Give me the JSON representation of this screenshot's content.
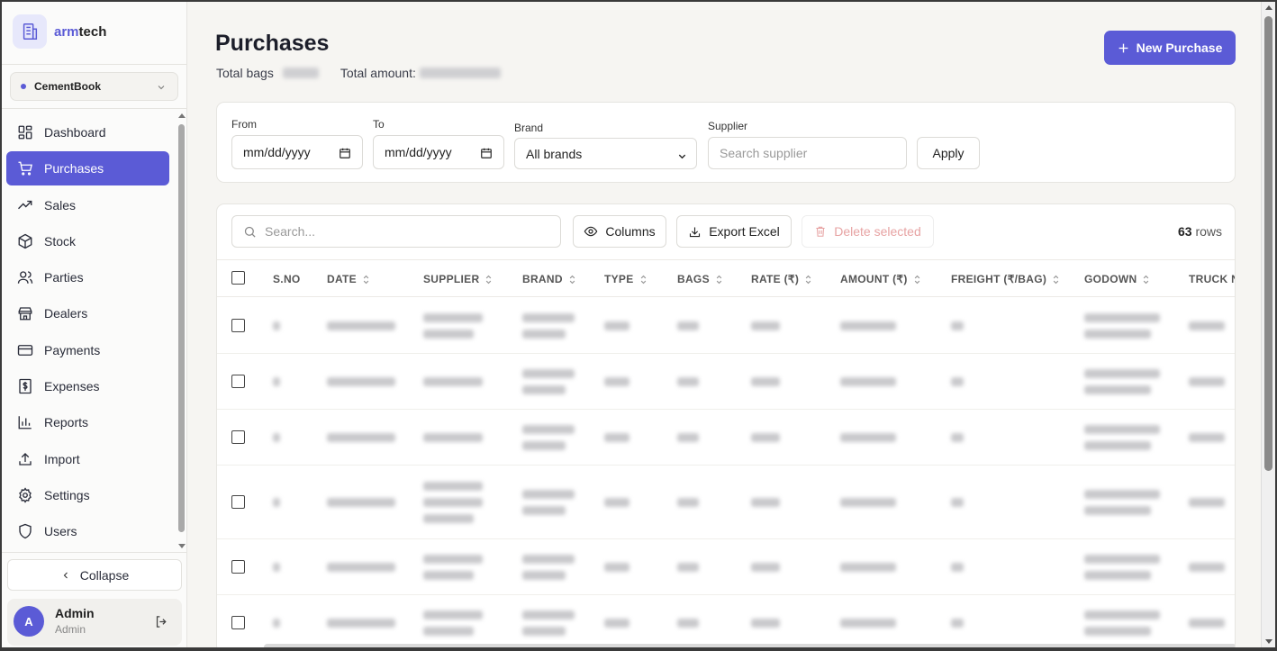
{
  "app": {
    "brand_prefix": "arm",
    "brand_suffix": "tech"
  },
  "company": {
    "name": "CementBook"
  },
  "nav": {
    "items": [
      {
        "label": "Dashboard",
        "icon": "dashboard-icon"
      },
      {
        "label": "Purchases",
        "icon": "cart-icon",
        "active": true
      },
      {
        "label": "Sales",
        "icon": "trend-icon"
      },
      {
        "label": "Stock",
        "icon": "box-icon"
      },
      {
        "label": "Parties",
        "icon": "users-icon"
      },
      {
        "label": "Dealers",
        "icon": "store-icon"
      },
      {
        "label": "Payments",
        "icon": "card-icon"
      },
      {
        "label": "Expenses",
        "icon": "receipt-icon"
      },
      {
        "label": "Reports",
        "icon": "bar-chart-icon"
      },
      {
        "label": "Import",
        "icon": "upload-icon"
      },
      {
        "label": "Settings",
        "icon": "gear-icon"
      },
      {
        "label": "Users",
        "icon": "shield-icon"
      }
    ],
    "collapse_label": "Collapse"
  },
  "user": {
    "initial": "A",
    "name": "Admin",
    "role": "Admin"
  },
  "header": {
    "title": "Purchases",
    "total_bags_label": "Total bags",
    "total_amount_label": "Total amount:",
    "new_button": "New Purchase"
  },
  "filters": {
    "from_label": "From",
    "from_placeholder": "mm/dd/yyyy",
    "to_label": "To",
    "to_placeholder": "mm/dd/yyyy",
    "brand_label": "Brand",
    "brand_value": "All brands",
    "supplier_label": "Supplier",
    "supplier_placeholder": "Search supplier",
    "apply_label": "Apply"
  },
  "toolbar": {
    "search_placeholder": "Search...",
    "columns_label": "Columns",
    "export_label": "Export Excel",
    "delete_label": "Delete selected",
    "row_count": "63",
    "row_count_suffix": "rows"
  },
  "table": {
    "columns": [
      "S.NO",
      "DATE",
      "SUPPLIER",
      "BRAND",
      "TYPE",
      "BAGS",
      "RATE (₹)",
      "AMOUNT (₹)",
      "FREIGHT (₹/BAG)",
      "GODOWN",
      "TRUCK N"
    ],
    "rows": [
      {
        "supplier_lines": 2,
        "brand_lines": 2,
        "godown_lines": 2
      },
      {
        "supplier_lines": 1,
        "brand_lines": 2,
        "godown_lines": 2
      },
      {
        "supplier_lines": 1,
        "brand_lines": 2,
        "godown_lines": 2
      },
      {
        "supplier_lines": 3,
        "brand_lines": 2,
        "godown_lines": 2
      },
      {
        "supplier_lines": 2,
        "brand_lines": 2,
        "godown_lines": 2
      },
      {
        "supplier_lines": 2,
        "brand_lines": 2,
        "godown_lines": 2
      }
    ]
  },
  "colors": {
    "accent": "#5b5bd6",
    "sidebar_bg": "#fbfbfa",
    "page_bg": "#f6f5f2"
  }
}
